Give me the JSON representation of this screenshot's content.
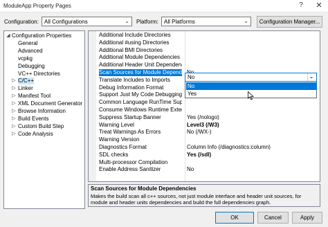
{
  "window": {
    "title": "ModuleApp Property Pages",
    "help_glyph": "?",
    "close_glyph": "✕"
  },
  "config": {
    "configuration_label": "Configuration:",
    "configuration_value": "All Configurations",
    "platform_label": "Platform:",
    "platform_value": "All Platforms",
    "manager_button": "Configuration Manager..."
  },
  "tree": {
    "items": [
      {
        "label": "Configuration Properties",
        "toggle": "◢"
      },
      {
        "label": "General"
      },
      {
        "label": "Advanced"
      },
      {
        "label": "vcpkg"
      },
      {
        "label": "Debugging"
      },
      {
        "label": "VC++ Directories"
      },
      {
        "label": "C/C++",
        "toggle": "▷"
      },
      {
        "label": "Linker",
        "toggle": "▷"
      },
      {
        "label": "Manifest Tool",
        "toggle": "▷"
      },
      {
        "label": "XML Document Generator",
        "toggle": "▷"
      },
      {
        "label": "Browse Information",
        "toggle": "▷"
      },
      {
        "label": "Build Events",
        "toggle": "▷"
      },
      {
        "label": "Custom Build Step",
        "toggle": "▷"
      },
      {
        "label": "Code Analysis",
        "toggle": "▷"
      }
    ]
  },
  "grid": {
    "rows": [
      {
        "name": "Additional Include Directories",
        "value": ""
      },
      {
        "name": "Additional #using Directories",
        "value": ""
      },
      {
        "name": "Additional BMI Directories",
        "value": ""
      },
      {
        "name": "Additional Module Dependencies",
        "value": ""
      },
      {
        "name": "Additional Header Unit Dependencies",
        "value": ""
      },
      {
        "name": "Scan Sources for Module Dependencies",
        "value": "No"
      },
      {
        "name": "Translate Includes to Imports",
        "value": ""
      },
      {
        "name": "Debug Information Format",
        "value": ""
      },
      {
        "name": "Support Just My Code Debugging",
        "value": "<different options>"
      },
      {
        "name": "Common Language RunTime Support",
        "value": ""
      },
      {
        "name": "Consume Windows Runtime Extension",
        "value": ""
      },
      {
        "name": "Suppress Startup Banner",
        "value": "Yes (/nologo)"
      },
      {
        "name": "Warning Level",
        "value": "Level3 (/W3)"
      },
      {
        "name": "Treat Warnings As Errors",
        "value": "No (/WX-)"
      },
      {
        "name": "Warning Version",
        "value": ""
      },
      {
        "name": "Diagnostics Format",
        "value": "Column Info (/diagnostics:column)"
      },
      {
        "name": "SDL checks",
        "value": "Yes (/sdl)"
      },
      {
        "name": "Multi-processor Compilation",
        "value": ""
      },
      {
        "name": "Enable Address Sanitizer",
        "value": "No"
      }
    ]
  },
  "dropdown": {
    "value": "No",
    "arrow_glyph": "⌄",
    "options": [
      "No",
      "Yes"
    ]
  },
  "description": {
    "title": "Scan Sources for Module Dependencies",
    "text": "Makes the build scan all c++ sources, not just module interface and header unit sources, for module and header units dependencies and build the full dependencies graph."
  },
  "buttons": {
    "ok": "OK",
    "cancel": "Cancel",
    "apply": "Apply"
  }
}
